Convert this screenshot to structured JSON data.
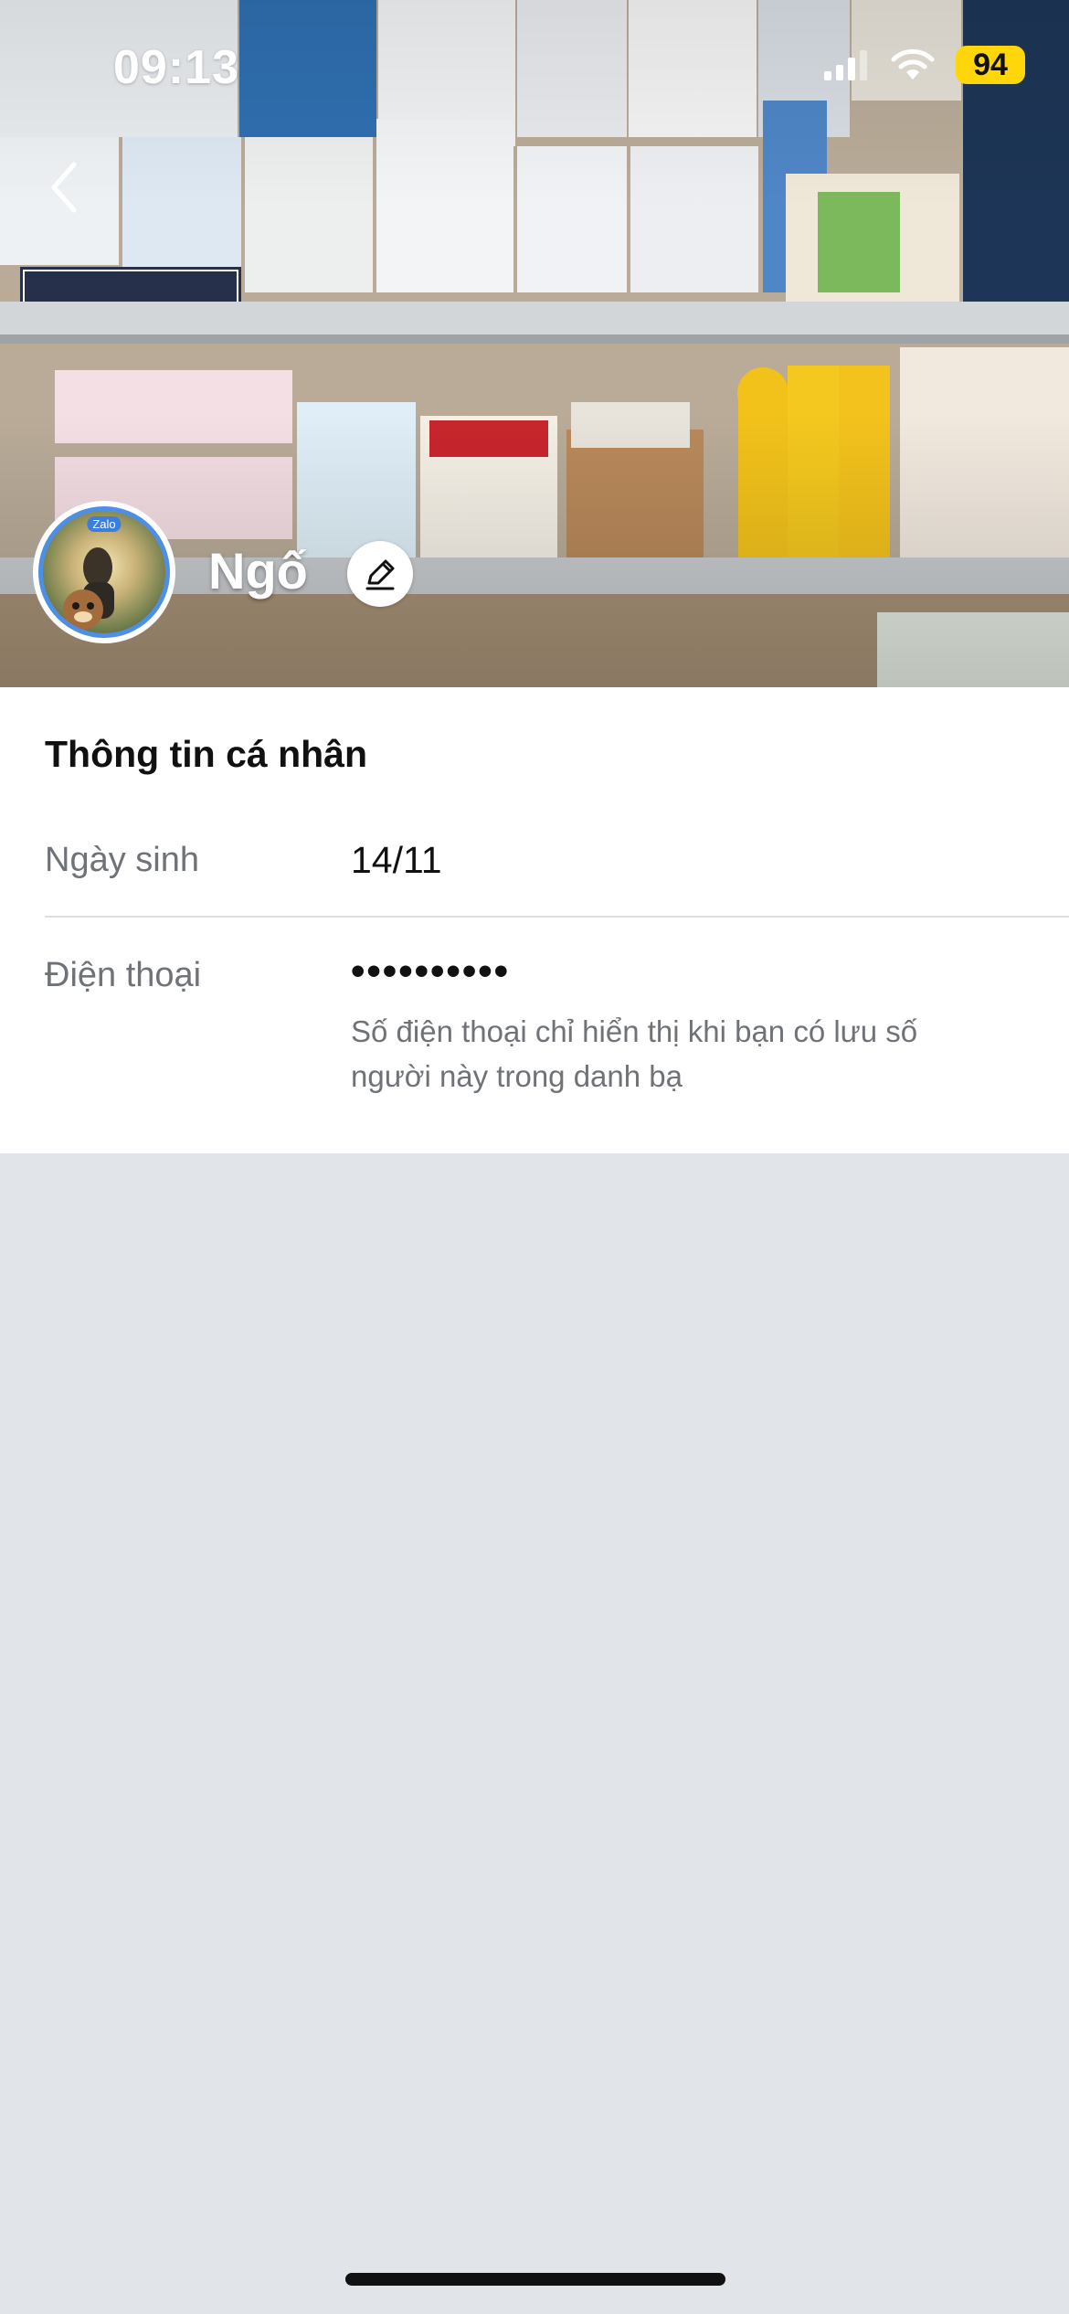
{
  "status_bar": {
    "time": "09:13",
    "battery_level": "94",
    "icons": [
      "signal-icon",
      "wifi-icon",
      "battery-icon"
    ],
    "battery_color": "#ffd60a"
  },
  "header": {
    "back_icon": "chevron-left-icon",
    "cover_photo_subject": "pharmacy shelves with medical devices",
    "avatar_badge": "Zalo",
    "profile_name": "Ngố",
    "edit_icon": "pencil-icon",
    "avatar_ring_color": "#4d8fe6"
  },
  "info_card": {
    "title": "Thông tin cá nhân",
    "birthday": {
      "label": "Ngày sinh",
      "value": "14/11"
    },
    "phone": {
      "label": "Điện thoại",
      "value": "••••••••••",
      "note": "Số điện thoại chỉ hiển thị khi bạn có lưu số người này trong danh bạ"
    }
  },
  "colors": {
    "page_background": "#e1e4e8",
    "card_background": "#ffffff",
    "muted_text": "#6f7378",
    "primary_text": "#111111"
  }
}
